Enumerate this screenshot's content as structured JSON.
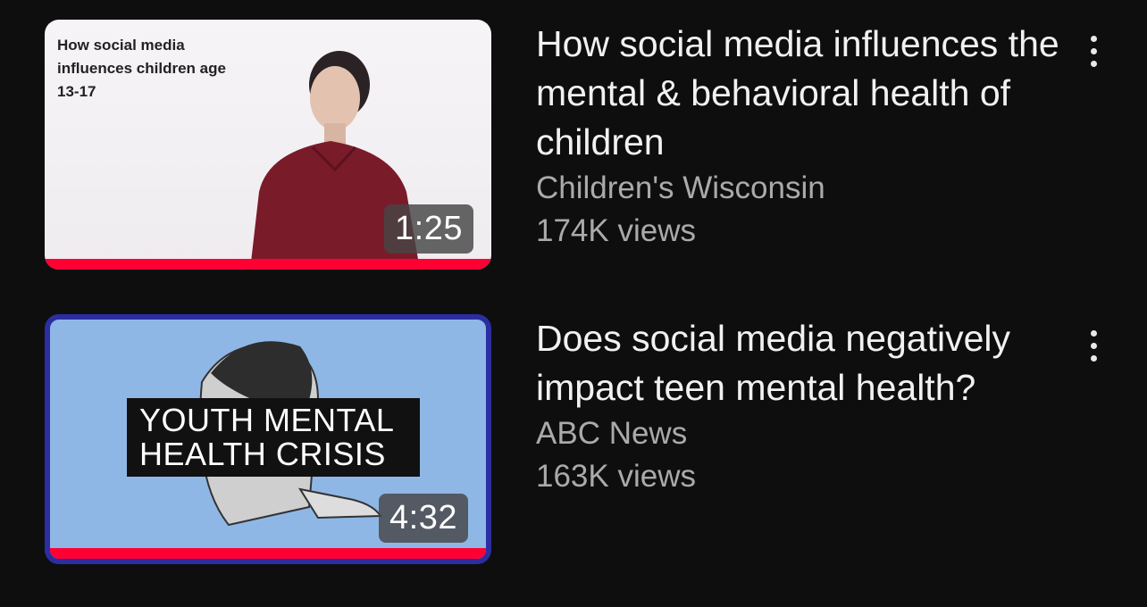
{
  "videos": [
    {
      "thumbnail_text": "How social media influences children age 13-17",
      "duration": "1:25",
      "title": "How social media influences the mental & behavioral health of children",
      "channel": "Children's Wisconsin",
      "views": "174K views",
      "watched_fraction": 1.0
    },
    {
      "thumbnail_text": "YOUTH MENTAL HEALTH CRISIS",
      "duration": "4:32",
      "title": "Does social media negatively impact teen mental health?",
      "channel": "ABC News",
      "views": "163K views",
      "watched_fraction": 1.0
    }
  ],
  "colors": {
    "background": "#0f0e0f",
    "progress": "#ff0033",
    "title": "#f1f1f1",
    "secondary": "#aaaaaa"
  },
  "icons": {
    "more": "more-vertical-icon"
  }
}
